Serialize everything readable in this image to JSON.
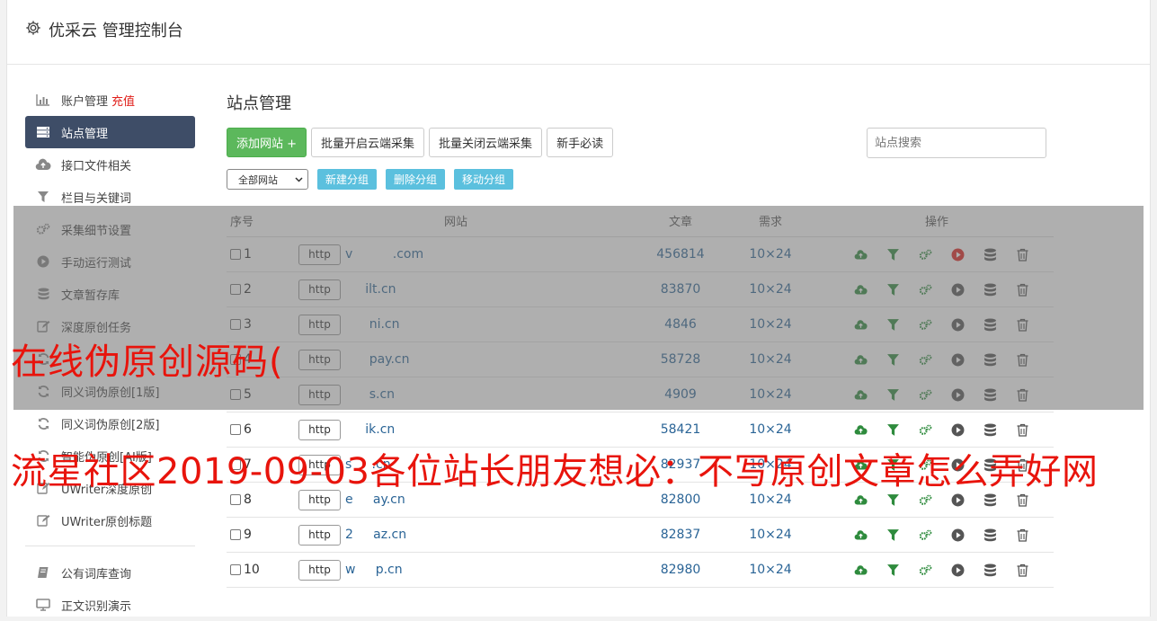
{
  "app": {
    "title": "优采云 管理控制台",
    "icon": "gear-icon"
  },
  "sidebar": {
    "items": [
      {
        "label": "账户管理",
        "badge": "充值",
        "icon": "bar-chart-icon"
      },
      {
        "label": "站点管理",
        "icon": "server-icon",
        "active": true
      },
      {
        "label": "接口文件相关",
        "icon": "cloud-upload-icon"
      },
      {
        "label": "栏目与关键词",
        "icon": "filter-icon"
      },
      {
        "label": "采集细节设置",
        "icon": "gears-icon"
      },
      {
        "label": "手动运行测试",
        "icon": "play-circle-icon"
      },
      {
        "label": "文章暂存库",
        "icon": "database-icon"
      },
      {
        "label": "深度原创任务",
        "icon": "edit-icon"
      },
      {
        "label": "",
        "icon": "refresh-icon"
      },
      {
        "label": "同义词伪原创[1版]",
        "icon": "refresh-icon"
      },
      {
        "label": "同义词伪原创[2版]",
        "icon": "refresh-icon"
      },
      {
        "label": "智能伪原创[AI版]",
        "icon": "refresh-icon"
      },
      {
        "label": "UWriter深度原创",
        "icon": "edit-icon"
      },
      {
        "label": "UWriter原创标题",
        "icon": "edit-icon"
      }
    ],
    "bottom": [
      {
        "label": "公有词库查询",
        "icon": "book-icon"
      },
      {
        "label": "正文识别演示",
        "icon": "monitor-icon"
      }
    ]
  },
  "main": {
    "title": "站点管理",
    "toolbar": {
      "add": "添加网站 +",
      "open_cloud": "批量开启云端采集",
      "close_cloud": "批量关闭云端采集",
      "guide": "新手必读"
    },
    "search_placeholder": "站点搜索",
    "group_select": "全部网站",
    "group_buttons": {
      "new": "新建分组",
      "delete": "删除分组",
      "move": "移动分组"
    },
    "columns": {
      "no": "序号",
      "site": "网站",
      "articles": "文章",
      "demand": "需求",
      "ops": "操作"
    },
    "rows": [
      {
        "no": "1",
        "proto": "http",
        "domain": "v          .com",
        "articles": "456814",
        "demand": "10×24",
        "running": true
      },
      {
        "no": "2",
        "proto": "http",
        "domain": "     ilt.cn",
        "articles": "83870",
        "demand": "10×24"
      },
      {
        "no": "3",
        "proto": "http",
        "domain": "      ni.cn",
        "articles": "4846",
        "demand": "10×24"
      },
      {
        "no": "4",
        "proto": "http",
        "domain": "      pay.cn",
        "articles": "58728",
        "demand": "10×24"
      },
      {
        "no": "5",
        "proto": "http",
        "domain": "      s.cn",
        "articles": "4909",
        "demand": "10×24"
      },
      {
        "no": "6",
        "proto": "http",
        "domain": "     ik.cn",
        "articles": "58421",
        "demand": "10×24"
      },
      {
        "no": "7",
        "proto": "http",
        "domain": "s     .cn",
        "articles": "82937",
        "demand": "10×24"
      },
      {
        "no": "8",
        "proto": "http",
        "domain": "e     ay.cn",
        "articles": "82800",
        "demand": "10×24"
      },
      {
        "no": "9",
        "proto": "http",
        "domain": "2     az.cn",
        "articles": "82837",
        "demand": "10×24"
      },
      {
        "no": "10",
        "proto": "http",
        "domain": "w     p.cn",
        "articles": "82980",
        "demand": "10×24"
      }
    ]
  },
  "captions": {
    "line1": "在线伪原创源码(",
    "line2": "流星社区2019-09-03各位站长朋友想必：不写原创文章怎么弄好网"
  },
  "colors": {
    "accent_green": "#5cb85c",
    "info_blue": "#5bc0de",
    "sidebar_active": "#3e4d67",
    "caption_red": "#e8140c",
    "link_blue": "#2a6496"
  }
}
